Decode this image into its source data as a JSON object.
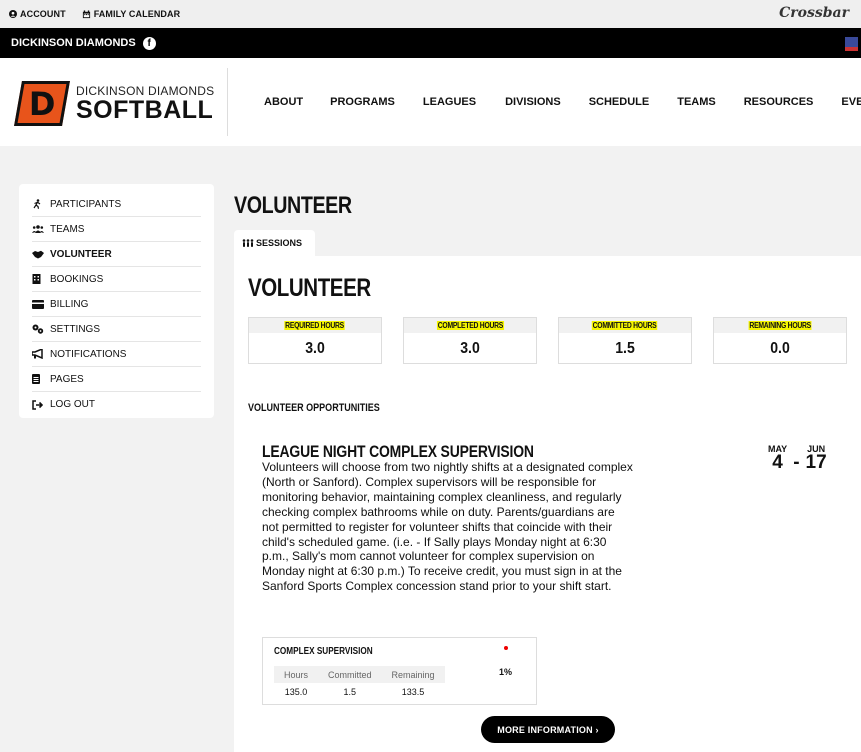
{
  "util": {
    "account": "ACCOUNT",
    "calendar": "FAMILY CALENDAR",
    "brand": "Crossbar"
  },
  "teambar": {
    "name": "DICKINSON DIAMONDS"
  },
  "logo": {
    "line1": "DICKINSON DIAMONDS",
    "line2": "SOFTBALL",
    "mark": "D"
  },
  "nav": [
    "ABOUT",
    "PROGRAMS",
    "LEAGUES",
    "DIVISIONS",
    "SCHEDULE",
    "TEAMS",
    "RESOURCES",
    "EVENTS"
  ],
  "sidebar": {
    "items": [
      {
        "label": "PARTICIPANTS",
        "icon": "runner-icon"
      },
      {
        "label": "TEAMS",
        "icon": "users-icon"
      },
      {
        "label": "VOLUNTEER",
        "icon": "handshake-icon"
      },
      {
        "label": "BOOKINGS",
        "icon": "building-icon"
      },
      {
        "label": "BILLING",
        "icon": "credit-card-icon"
      },
      {
        "label": "SETTINGS",
        "icon": "gears-icon"
      },
      {
        "label": "NOTIFICATIONS",
        "icon": "megaphone-icon"
      },
      {
        "label": "PAGES",
        "icon": "file-icon"
      },
      {
        "label": "LOG OUT",
        "icon": "logout-icon"
      }
    ]
  },
  "main": {
    "page_title": "VOLUNTEER",
    "tab_label": "SESSIONS",
    "section_title": "VOLUNTEER",
    "hours": [
      {
        "label": "REQUIRED HOURS",
        "value": "3.0"
      },
      {
        "label": "COMPLETED HOURS",
        "value": "3.0"
      },
      {
        "label": "COMMITTED HOURS",
        "value": "1.5"
      },
      {
        "label": "REMAINING HOURS",
        "value": "0.0"
      }
    ],
    "opps_title": "VOLUNTEER OPPORTUNITIES",
    "opportunity": {
      "name": "LEAGUE NIGHT COMPLEX SUPERVISION",
      "description": "Volunteers will choose from two nightly shifts at a designated complex (North or Sanford). Complex supervisors will be responsible for monitoring behavior, maintaining complex cleanliness, and regularly checking complex bathrooms while on duty. Parents/guardians are not permitted to register for volunteer shifts that coincide with their child's scheduled game. (i.e. - If Sally plays Monday night at 6:30 p.m., Sally's mom cannot volunteer for complex supervision on Monday night at 6:30 p.m.) To receive credit, you must sign in at the Sanford Sports Complex concession stand prior to your shift start.",
      "start_month": "MAY",
      "start_day": "4",
      "end_month": "JUN",
      "end_day": "17",
      "dash": "-",
      "shift": {
        "name": "COMPLEX SUPERVISION",
        "headers": [
          "Hours",
          "Committed",
          "Remaining"
        ],
        "values": [
          "135.0",
          "1.5",
          "133.5"
        ],
        "percent": "1%"
      },
      "more_button": "MORE INFORMATION ›"
    }
  }
}
